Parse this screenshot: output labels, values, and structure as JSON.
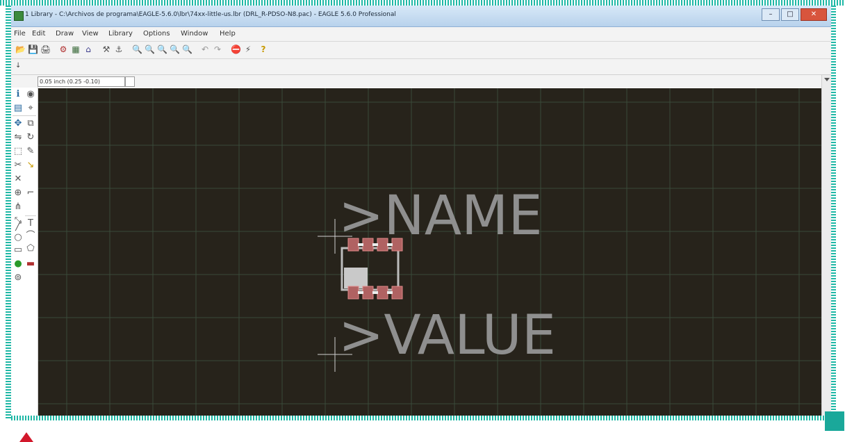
{
  "window": {
    "title": "1 Library - C:\\Archivos de programa\\EAGLE-5.6.0\\lbr\\74xx-little-us.lbr (DRL_R-PDSO-N8.pac) - EAGLE 5.6.0 Professional",
    "controls": [
      "–",
      "□",
      "✕"
    ]
  },
  "menu": [
    "File",
    "Edit",
    "Draw",
    "View",
    "Library",
    "Options",
    "Window",
    "Help"
  ],
  "toolbar": {
    "icons": [
      "open-icon",
      "save-icon",
      "print-icon",
      "cam-icon",
      "board-icon",
      "script-icon",
      "run-ulp-icon",
      "design-link-icon",
      "zoom-fit-icon",
      "zoom-in-icon",
      "zoom-out-icon",
      "redraw-icon",
      "zoom-select-icon",
      "undo-icon",
      "redo-icon",
      "stop-icon",
      "go-icon",
      "help-icon"
    ],
    "glyphs": [
      "📂",
      "💾",
      "🖨",
      "⚙",
      "▦",
      "⌂",
      "⚒",
      "⚓",
      "🔍",
      "🔍",
      "🔍",
      "🔍",
      "🔍",
      "↶",
      "↷",
      "⛔",
      "⚡",
      "?"
    ]
  },
  "coords": {
    "readout": "0.05 inch (0.25 -0.10)"
  },
  "left_tools": [
    "info-icon",
    "show-icon",
    "display-icon",
    "mark-icon",
    "move-icon",
    "copy-icon",
    "mirror-icon",
    "rotate-icon",
    "group-icon",
    "change-icon",
    "cut-icon",
    "paste-icon",
    "delete-icon",
    "add-icon",
    "name-icon",
    "value-icon",
    "smash-icon",
    "miter-icon",
    "split-icon",
    "optimize-icon",
    "route-icon",
    "ripup-icon",
    "wire-icon",
    "text-icon",
    "circle-icon",
    "arc-icon",
    "rect-icon",
    "polygon-icon",
    "via-icon",
    "hole-icon",
    "attribute-icon"
  ],
  "canvas": {
    "name_text": ">NAME",
    "value_text": ">VALUE",
    "background": "#27231b",
    "text_color": "#8f8f8f",
    "pad_color": "#b06262"
  },
  "colors": {
    "accent": "#1fb8a6",
    "brand_teal": "#1aa89a",
    "marker_red": "#d2182b"
  }
}
